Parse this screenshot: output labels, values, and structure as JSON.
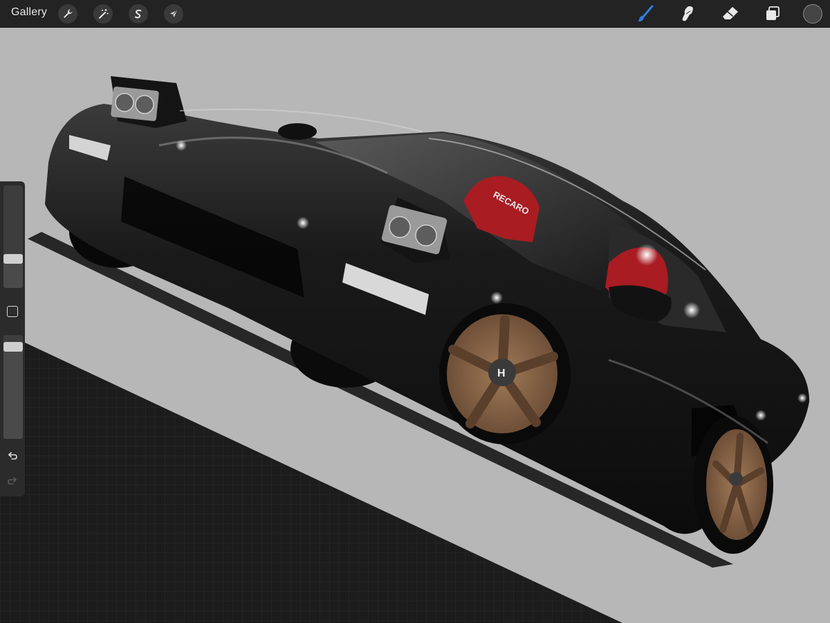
{
  "toolbar": {
    "gallery_label": "Gallery",
    "left_tools": [
      {
        "name": "actions-wrench-icon",
        "title": "Actions"
      },
      {
        "name": "adjustments-wand-icon",
        "title": "Adjustments"
      },
      {
        "name": "selection-s-icon",
        "title": "Selection"
      },
      {
        "name": "transform-arrow-icon",
        "title": "Transform"
      }
    ],
    "right_tools": [
      {
        "name": "brush-icon",
        "active": true
      },
      {
        "name": "smudge-icon",
        "active": false
      },
      {
        "name": "eraser-icon",
        "active": false
      },
      {
        "name": "layers-icon",
        "active": false
      }
    ],
    "active_color": "#454545",
    "accent_color": "#2f7ddf"
  },
  "sidebar": {
    "brush_size_level": 0.26,
    "opacity_level": 0.93
  },
  "canvas": {
    "badge_text": "RECARO",
    "wheel_logo": "H",
    "background_gray": "#b7b7b7",
    "paint_color": "#151515",
    "seat_color": "#a81c22",
    "wheel_color": "#8a6446"
  }
}
